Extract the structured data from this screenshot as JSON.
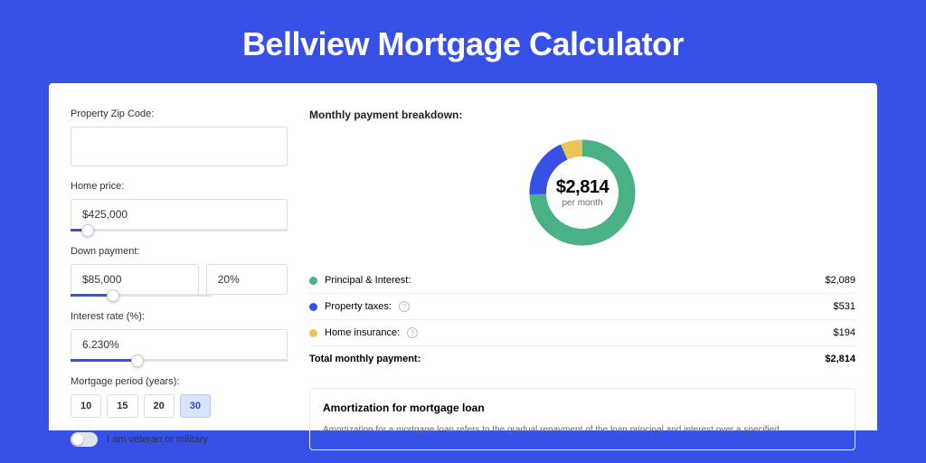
{
  "title": "Bellview Mortgage Calculator",
  "form": {
    "zip": {
      "label": "Property Zip Code:",
      "value": ""
    },
    "homePrice": {
      "label": "Home price:",
      "value": "$425,000",
      "sliderPct": 8
    },
    "downPayment": {
      "label": "Down payment:",
      "amount": "$85,000",
      "pct": "20%",
      "sliderPct": 20
    },
    "interest": {
      "label": "Interest rate (%):",
      "value": "6.230%",
      "sliderPct": 31
    },
    "period": {
      "label": "Mortgage period (years):",
      "options": [
        "10",
        "15",
        "20",
        "30"
      ],
      "selected": "30"
    },
    "veteran": {
      "label": "I am veteran or military",
      "checked": false
    }
  },
  "breakdown": {
    "heading": "Monthly payment breakdown:",
    "total": "$2,814",
    "totalSub": "per month",
    "rows": [
      {
        "label": "Principal & Interest:",
        "value": "$2,089",
        "color": "#49B185",
        "hasInfo": false
      },
      {
        "label": "Property taxes:",
        "value": "$531",
        "color": "#3751E6",
        "hasInfo": true
      },
      {
        "label": "Home insurance:",
        "value": "$194",
        "color": "#EAC65A",
        "hasInfo": true
      }
    ],
    "totalRow": {
      "label": "Total monthly payment:",
      "value": "$2,814"
    }
  },
  "chart_data": {
    "type": "pie",
    "title": "Monthly payment breakdown:",
    "series": [
      {
        "name": "Principal & Interest",
        "value": 2089,
        "color": "#49B185"
      },
      {
        "name": "Property taxes",
        "value": 531,
        "color": "#3751E6"
      },
      {
        "name": "Home insurance",
        "value": 194,
        "color": "#EAC65A"
      }
    ],
    "total": 2814,
    "center_label": "$2,814",
    "center_sublabel": "per month"
  },
  "amort": {
    "heading": "Amortization for mortgage loan",
    "text": "Amortization for a mortgage loan refers to the gradual repayment of the loan principal and interest over a specified"
  }
}
